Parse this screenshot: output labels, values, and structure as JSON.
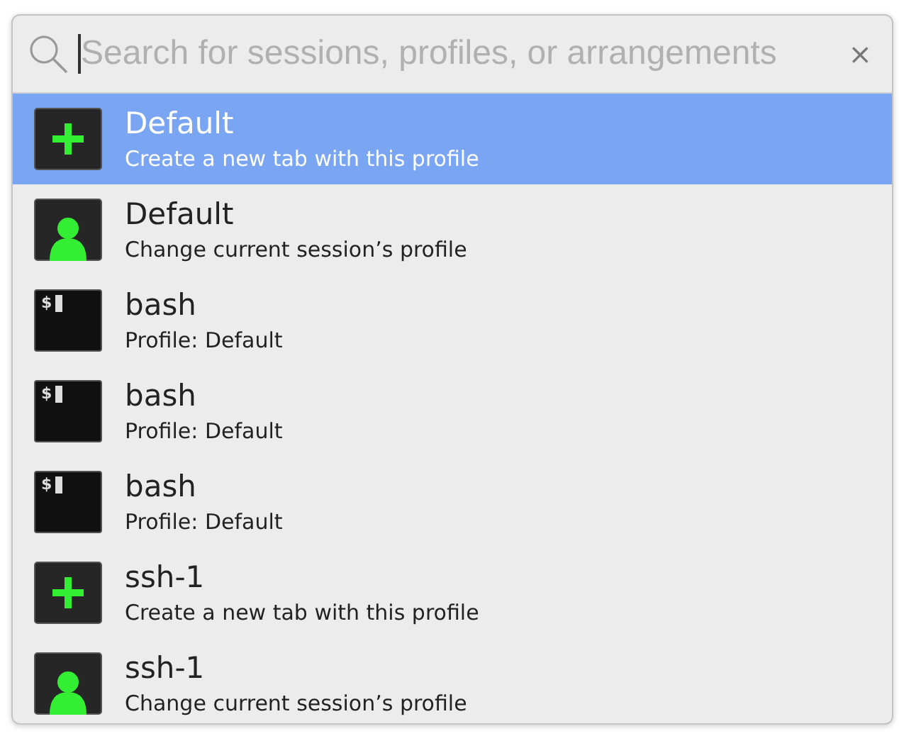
{
  "search": {
    "placeholder": "Search for sessions, profiles, or arrangements",
    "clear": "×"
  },
  "items": [
    {
      "kind": "new_tab",
      "title": "Default",
      "subtitle": "Create a new tab with this profile",
      "selected": true
    },
    {
      "kind": "change_profile",
      "title": "Default",
      "subtitle": "Change current session’s profile",
      "selected": false
    },
    {
      "kind": "session",
      "prompt": "$",
      "title": "bash",
      "subtitle": "Profile: Default",
      "selected": false
    },
    {
      "kind": "session",
      "prompt": "$",
      "title": "bash",
      "subtitle": "Profile: Default",
      "selected": false
    },
    {
      "kind": "session",
      "prompt": "$",
      "title": "bash",
      "subtitle": "Profile: Default",
      "selected": false
    },
    {
      "kind": "new_tab",
      "title": "ssh-1",
      "subtitle": "Create a new tab with this profile",
      "selected": false
    },
    {
      "kind": "change_profile",
      "title": "ssh-1",
      "subtitle": "Change current session’s profile",
      "selected": false
    }
  ]
}
